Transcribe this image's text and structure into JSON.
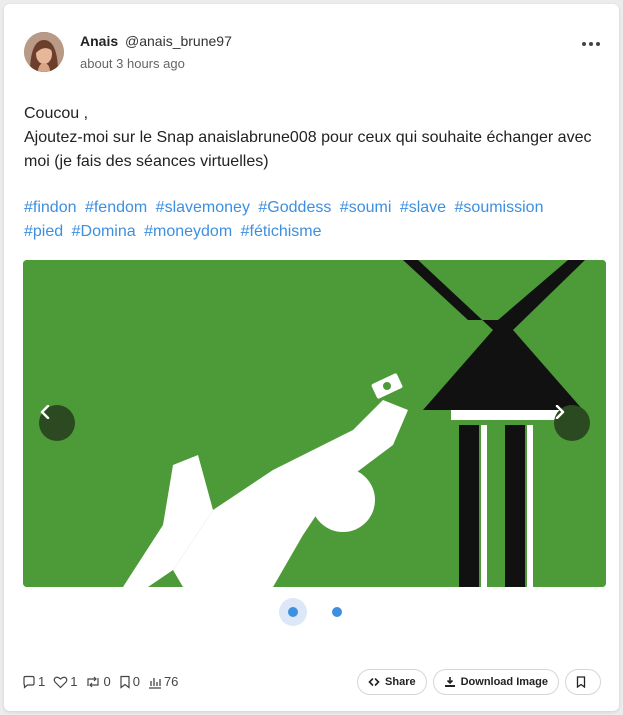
{
  "post": {
    "author_name": "Anais",
    "author_handle": "@anais_brune97",
    "timestamp": "about 3 hours ago",
    "text_line1": "Coucou ,",
    "text_line2": "Ajoutez-moi sur le Snap anaislabrune008 pour ceux qui souhaite échanger avec moi (je fais des séances virtuelles)",
    "hashtags": [
      "#findon",
      "#fendom",
      "#slavemoney",
      "#Goddess",
      "#soumi",
      "#slave",
      "#soumission",
      "#pied",
      "#Domina",
      "#moneydom",
      "#fétichisme"
    ]
  },
  "carousel": {
    "slide_count": 2,
    "active_index": 0,
    "background_color": "#4c9a38"
  },
  "stats": {
    "comments": "1",
    "likes": "1",
    "reposts": "0",
    "bookmarks": "0",
    "views": "76"
  },
  "actions": {
    "share_label": "Share",
    "download_label": "Download Image"
  },
  "colors": {
    "accent": "#3d8fe0"
  }
}
